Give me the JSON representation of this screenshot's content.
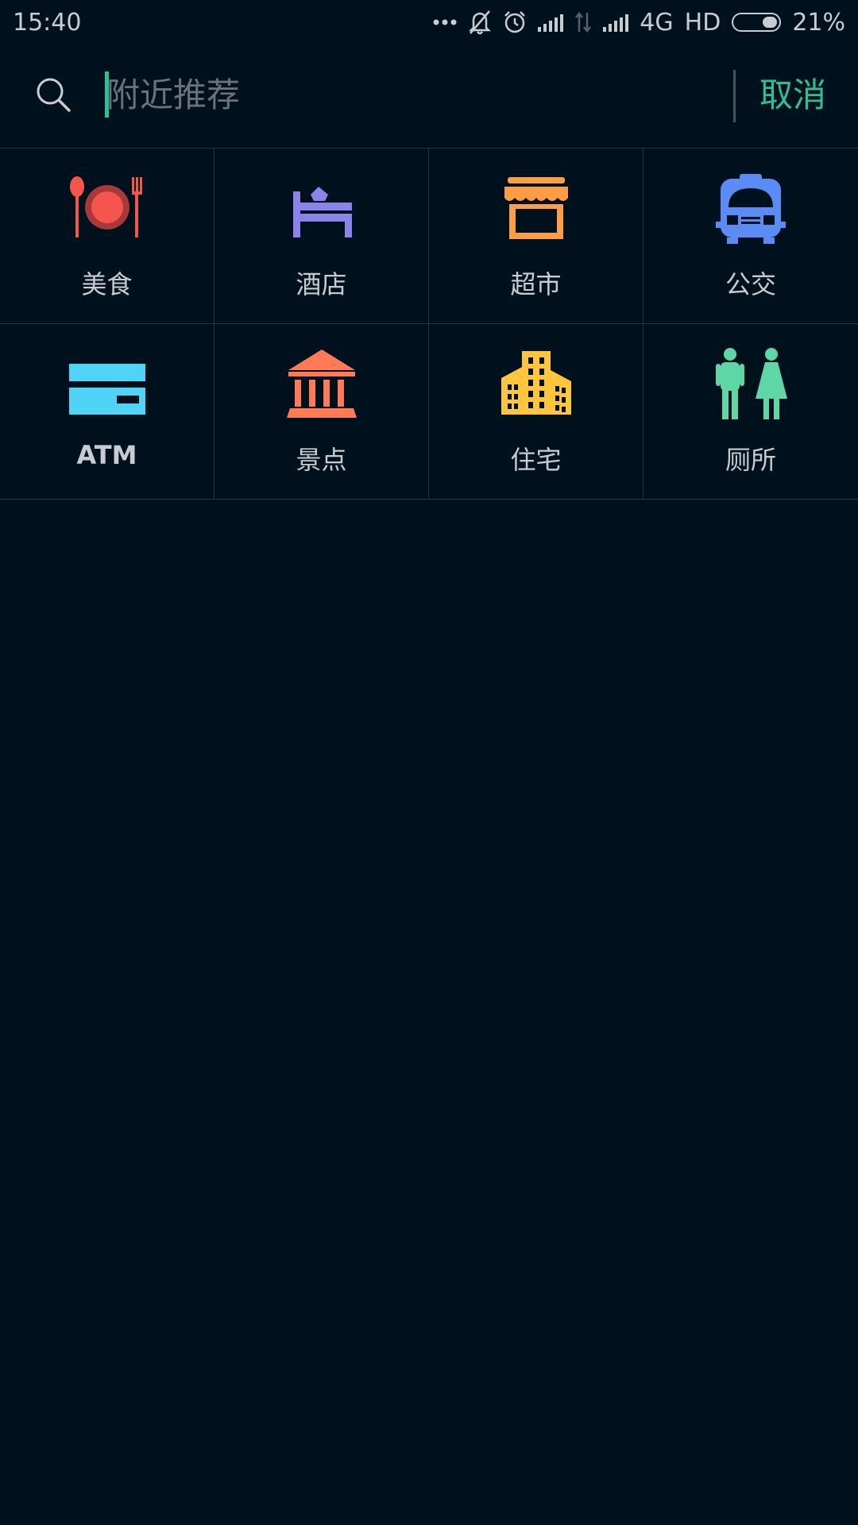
{
  "status_bar": {
    "time": "15:40",
    "network": "4G",
    "hd": "HD",
    "battery": "21%",
    "battery_level": 0.21,
    "icons": [
      "more-dots-icon",
      "mute-bell-icon",
      "alarm-icon",
      "signal-icon",
      "data-arrows-icon",
      "signal-icon"
    ]
  },
  "search": {
    "placeholder": "附近推荐",
    "value": "",
    "cancel_label": "取消"
  },
  "categories": [
    {
      "label": "美食",
      "icon": "food-icon",
      "color": "#f4564e"
    },
    {
      "label": "酒店",
      "icon": "hotel-bed-icon",
      "color": "#8b84e8"
    },
    {
      "label": "超市",
      "icon": "store-icon",
      "color": "#ff9d45"
    },
    {
      "label": "公交",
      "icon": "bus-icon",
      "color": "#5b8cf6"
    },
    {
      "label": "ATM",
      "icon": "card-icon",
      "color": "#4fd3f7"
    },
    {
      "label": "景点",
      "icon": "landmark-icon",
      "color": "#ff7a55"
    },
    {
      "label": "住宅",
      "icon": "building-icon",
      "color": "#ffc53d"
    },
    {
      "label": "厕所",
      "icon": "restroom-icon",
      "color": "#5fd6a5"
    }
  ],
  "colors": {
    "background": "#00111e",
    "accent": "#2fbf95",
    "divider": "#2a3540"
  }
}
